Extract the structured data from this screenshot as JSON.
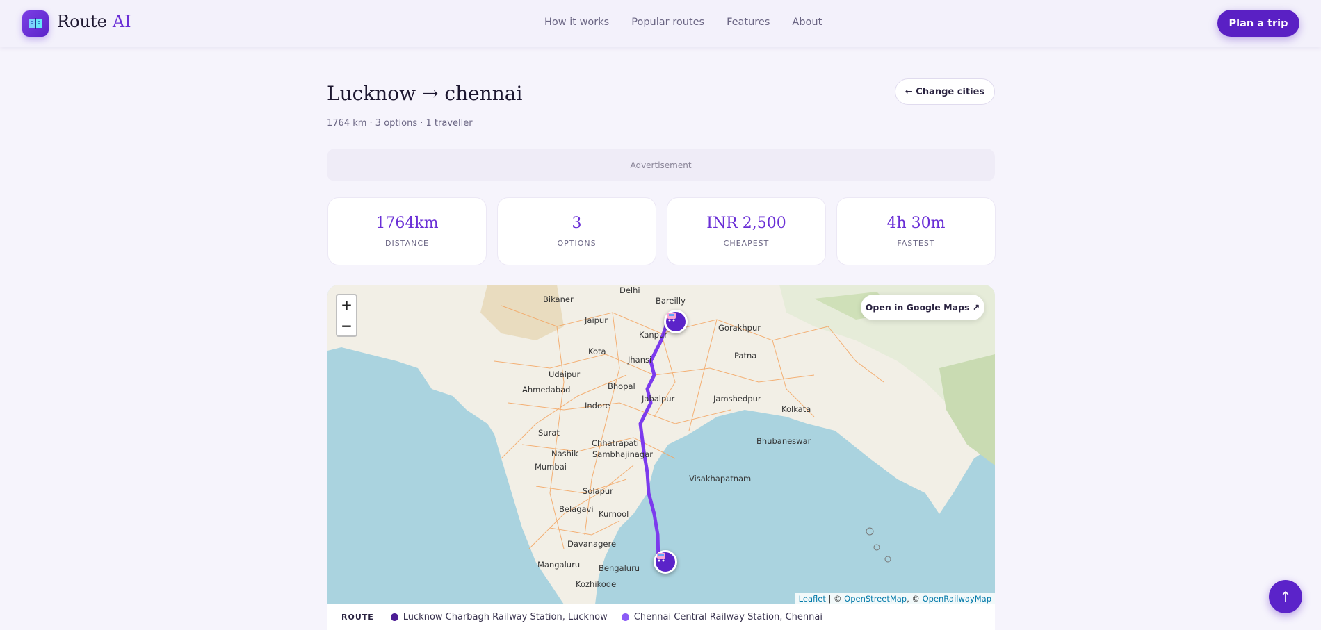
{
  "header": {
    "brand_first": "Route",
    "brand_second": "AI",
    "nav": [
      "How it works",
      "Popular routes",
      "Features",
      "About"
    ],
    "cta": "Plan a trip"
  },
  "trip": {
    "title": "Lucknow → chennai",
    "summary": "1764 km · 3 options · 1 traveller",
    "change_label": "← Change cities"
  },
  "ad_label": "Advertisement",
  "stats": [
    {
      "value": "1764km",
      "label": "DISTANCE"
    },
    {
      "value": "3",
      "label": "OPTIONS"
    },
    {
      "value": "INR 2,500",
      "label": "CHEAPEST"
    },
    {
      "value": "4h 30m",
      "label": "FASTEST"
    }
  ],
  "map": {
    "zoom_in": "+",
    "zoom_out": "−",
    "open_label": "Open in Google Maps ↗",
    "attribution_leaflet": "Leaflet",
    "attribution_sep1": " | © ",
    "attribution_osm": "OpenStreetMap",
    "attribution_sep2": ", © ",
    "attribution_orm": "OpenRailwayMap",
    "labels": [
      "Bikaner",
      "Jaipur",
      "Delhi",
      "Bareilly",
      "Kanpur",
      "Gorakhpur",
      "Kota",
      "Udaipur",
      "Jhansi",
      "Patna",
      "Ahmedabad",
      "Bhopal",
      "Jabalpur",
      "Jamshedpur",
      "Indore",
      "Kolkata",
      "Surat",
      "Chhatrapati",
      "Sambhajinagar",
      "Bhubaneswar",
      "Nashik",
      "Mumbai",
      "Solapur",
      "Visakhapatnam",
      "Belagavi",
      "Kurnool",
      "Davanagere",
      "Mangaluru",
      "Bengaluru",
      "Kozhikode"
    ],
    "route_color": "#7c3aed",
    "accent": "#5b23c9"
  },
  "route": {
    "label": "ROUTE",
    "from": "Lucknow Charbagh Railway Station, Lucknow",
    "from_color": "#4c1d95",
    "to": "Chennai Central Railway Station, Chennai",
    "to_color": "#8b5cf6"
  },
  "scroll_top": "↑"
}
